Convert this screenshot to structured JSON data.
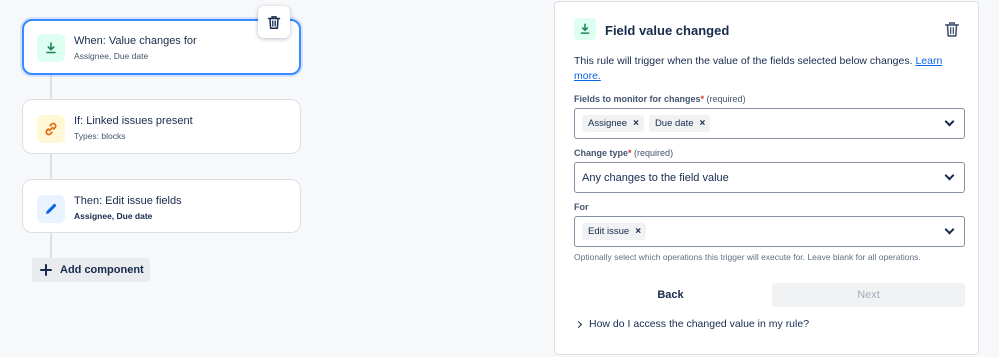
{
  "flow": {
    "trigger": {
      "title": "When: Value changes for",
      "subtitle": "Assignee, Due date",
      "icon": "trigger-download-icon"
    },
    "condition": {
      "title": "If: Linked issues present",
      "subtitle": "Types: blocks",
      "icon": "link-icon"
    },
    "action": {
      "title": "Then: Edit issue fields",
      "subtitle": "Assignee, Due date",
      "icon": "pencil-icon"
    },
    "add_component_label": "Add component"
  },
  "panel": {
    "title": "Field value changed",
    "description": "This rule will trigger when the value of the fields selected below changes.",
    "learn_more": "Learn more.",
    "fields_label": "Fields to monitor for changes",
    "fields_required_mark": "*",
    "fields_required_text": "(required)",
    "fields_selected": [
      "Assignee",
      "Due date"
    ],
    "change_type_label": "Change type",
    "change_type_required_mark": "*",
    "change_type_required_text": "(required)",
    "change_type_value": "Any changes to the field value",
    "for_label": "For",
    "for_selected": [
      "Edit issue"
    ],
    "for_helper": "Optionally select which operations this trigger will execute for. Leave blank for all operations.",
    "back_label": "Back",
    "next_label": "Next",
    "expander_label": "How do I access the changed value in my rule?"
  },
  "colors": {
    "accent": "#388bff",
    "trigger_icon_bg": "#dcfff1",
    "trigger_icon": "#1f845a",
    "condition_icon_bg": "#fff7d6",
    "condition_icon": "#e56910",
    "action_icon_bg": "#e9f2ff",
    "action_icon": "#0c66e4",
    "required": "#c9372c"
  }
}
